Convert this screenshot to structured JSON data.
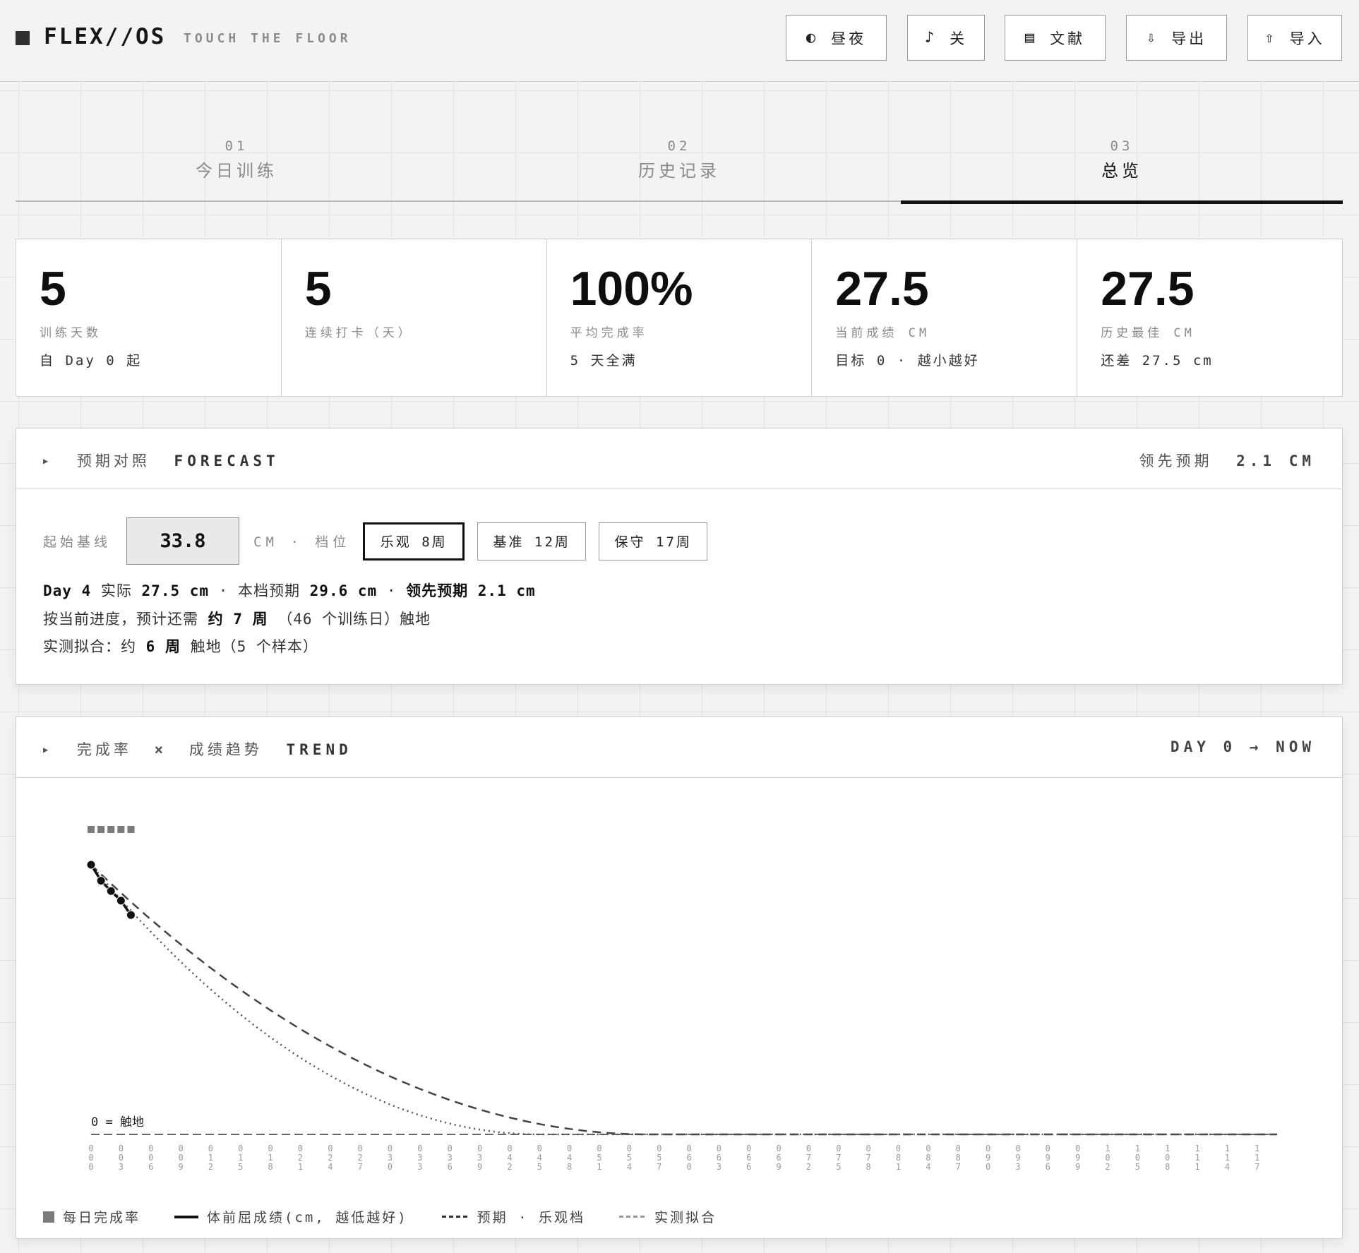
{
  "header": {
    "brand": "FLEX//OS",
    "tagline": "TOUCH THE FLOOR",
    "buttons": [
      {
        "icon": "contrast-icon",
        "glyph": "◐",
        "label": "昼夜"
      },
      {
        "icon": "music-note-icon",
        "glyph": "♪",
        "label": "关"
      },
      {
        "icon": "document-icon",
        "glyph": "▤",
        "label": "文献"
      },
      {
        "icon": "download-arrow-icon",
        "glyph": "⇩",
        "label": "导出"
      },
      {
        "icon": "upload-arrow-icon",
        "glyph": "⇧",
        "label": "导入"
      }
    ]
  },
  "tabs": [
    {
      "num": "01",
      "label": "今日训练"
    },
    {
      "num": "02",
      "label": "历史记录"
    },
    {
      "num": "03",
      "label": "总览",
      "active": true
    }
  ],
  "stats": [
    {
      "value": "5",
      "label": "训练天数",
      "sub": "自 Day 0 起"
    },
    {
      "value": "5",
      "label": "连续打卡（天）",
      "sub": ""
    },
    {
      "value": "100%",
      "label": "平均完成率",
      "sub": "5 天全满"
    },
    {
      "value": "27.5",
      "label": "当前成绩 CM",
      "sub": "目标 0 · 越小越好"
    },
    {
      "value": "27.5",
      "label": "历史最佳 CM",
      "sub": "还差 27.5 cm"
    }
  ],
  "forecast": {
    "title_cn": "预期对照",
    "title_en": "FORECAST",
    "lead_label": "领先预期",
    "lead_value": "2.1 CM",
    "baseline_label": "起始基线",
    "baseline_value": "33.8",
    "unit_sep": "CM · 档位",
    "tiers": [
      {
        "name": "乐观",
        "weeks": "8周",
        "active": true
      },
      {
        "name": "基准",
        "weeks": "12周",
        "active": false
      },
      {
        "name": "保守",
        "weeks": "17周",
        "active": false
      }
    ],
    "line1": {
      "day": "Day 4",
      "actual_label": "实际",
      "actual": "27.5 cm",
      "tier_label": "本档预期",
      "tier_val": "29.6 cm",
      "lead_label": "领先预期",
      "lead_val": "2.1 cm"
    },
    "line2": {
      "pre": "按当前进度，预计还需",
      "emph": "约 7 周",
      "post": "（46 个训练日）触地"
    },
    "line3": {
      "pre": "实测拟合：约",
      "emph": "6 周",
      "post": "触地（5 个样本）"
    }
  },
  "trend": {
    "title_cn_a": "完成率",
    "title_cross": "×",
    "title_cn_b": "成绩趋势",
    "title_en": "TREND",
    "range_label": "DAY 0 → NOW",
    "zero_label": "0 = 触地",
    "legend": [
      {
        "kind": "box",
        "label": "每日完成率"
      },
      {
        "kind": "line",
        "label": "体前屈成绩(cm, 越低越好)"
      },
      {
        "kind": "dash",
        "label": "预期 · 乐观档"
      },
      {
        "kind": "dash",
        "label": "实测拟合"
      }
    ]
  },
  "chart_data": {
    "type": "line",
    "x_ticks": [
      "000",
      "003",
      "006",
      "009",
      "012",
      "015",
      "018",
      "021",
      "024",
      "027",
      "030",
      "033",
      "036",
      "039",
      "042",
      "045",
      "048",
      "051",
      "054",
      "057",
      "060",
      "063",
      "066",
      "069",
      "072",
      "075",
      "078",
      "081",
      "084",
      "087",
      "090",
      "093",
      "096",
      "099",
      "102",
      "105",
      "108",
      "111",
      "114",
      "117"
    ],
    "xlim": [
      0,
      119
    ],
    "ylim": [
      0,
      33.8
    ],
    "series": [
      {
        "name": "每日完成率",
        "type": "bar",
        "x": [
          0,
          1,
          2,
          3,
          4
        ],
        "values": [
          100,
          100,
          100,
          100,
          100
        ]
      },
      {
        "name": "体前屈成绩(cm, 越低越好)",
        "x": [
          0,
          1,
          2,
          3,
          4
        ],
        "values": [
          33.8,
          31.8,
          30.5,
          29.3,
          27.5
        ]
      },
      {
        "name": "预期 · 乐观档",
        "style": "dashed",
        "model": "quadratic-to-zero",
        "start": 33.8,
        "zero_day": 56
      },
      {
        "name": "实测拟合",
        "style": "dotted",
        "model": "quadratic-to-zero",
        "start": 33.8,
        "zero_day": 45
      }
    ],
    "zero_line": 0
  }
}
